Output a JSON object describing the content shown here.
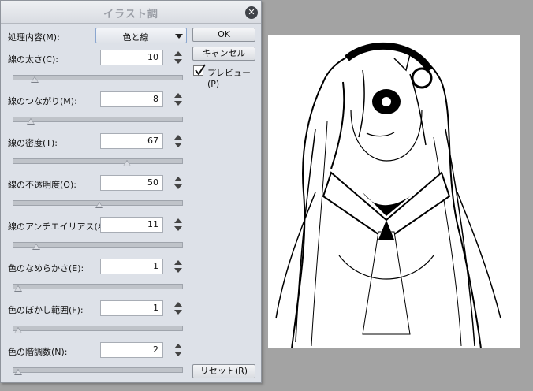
{
  "dialog": {
    "title": "イラスト調",
    "process_label": "処理内容(M):",
    "process_value": "色と線",
    "ok_label": "OK",
    "cancel_label": "キャンセル",
    "preview_label": "プレビュー(P)",
    "preview_checked": true,
    "reset_label": "リセット(R)",
    "params": [
      {
        "label": "線の太さ(C):",
        "value": "10",
        "slider": 0.1
      },
      {
        "label": "線のつながり(M):",
        "value": "8",
        "slider": 0.08
      },
      {
        "label": "線の密度(T):",
        "value": "67",
        "slider": 0.67
      },
      {
        "label": "線の不透明度(O):",
        "value": "50",
        "slider": 0.5
      },
      {
        "label": "線のアンチエイリアス(A):",
        "value": "11",
        "slider": 0.11
      },
      {
        "label": "色のなめらかさ(E):",
        "value": "1",
        "slider": 0.0
      },
      {
        "label": "色のぼかし範囲(F):",
        "value": "1",
        "slider": 0.0
      },
      {
        "label": "色の階調数(N):",
        "value": "2",
        "slider": 0.0
      }
    ]
  },
  "preview_image": {
    "subject": "anime girl line-art preview"
  },
  "colors": {
    "dialog_bg": "#dde1e8",
    "workspace_bg": "#a3a3a3",
    "accent_border": "#8aa6cf"
  }
}
